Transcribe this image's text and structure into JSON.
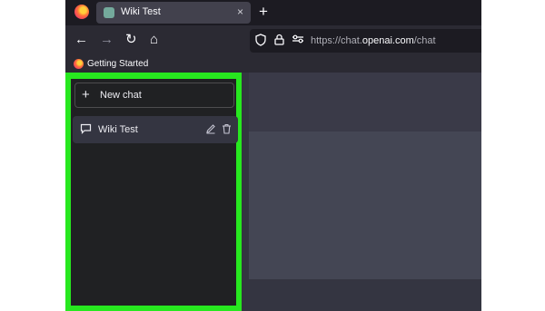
{
  "browser": {
    "tab": {
      "title": "Wiki Test",
      "close_icon": "×"
    },
    "new_tab_icon": "+",
    "nav": {
      "back": "←",
      "forward": "→",
      "reload": "↻",
      "home": "⌂"
    },
    "url": {
      "prefix": "https://chat.",
      "host": "openai.com",
      "path": "/chat"
    },
    "bookmarks": [
      {
        "label": "Getting Started"
      }
    ]
  },
  "sidebar": {
    "new_chat": {
      "icon": "+",
      "label": "New chat"
    },
    "conversations": [
      {
        "label": "Wiki Test"
      }
    ]
  },
  "colors": {
    "highlight": "#27e81f",
    "sidebar_bg": "#202123",
    "chat_bg": "#444654"
  }
}
